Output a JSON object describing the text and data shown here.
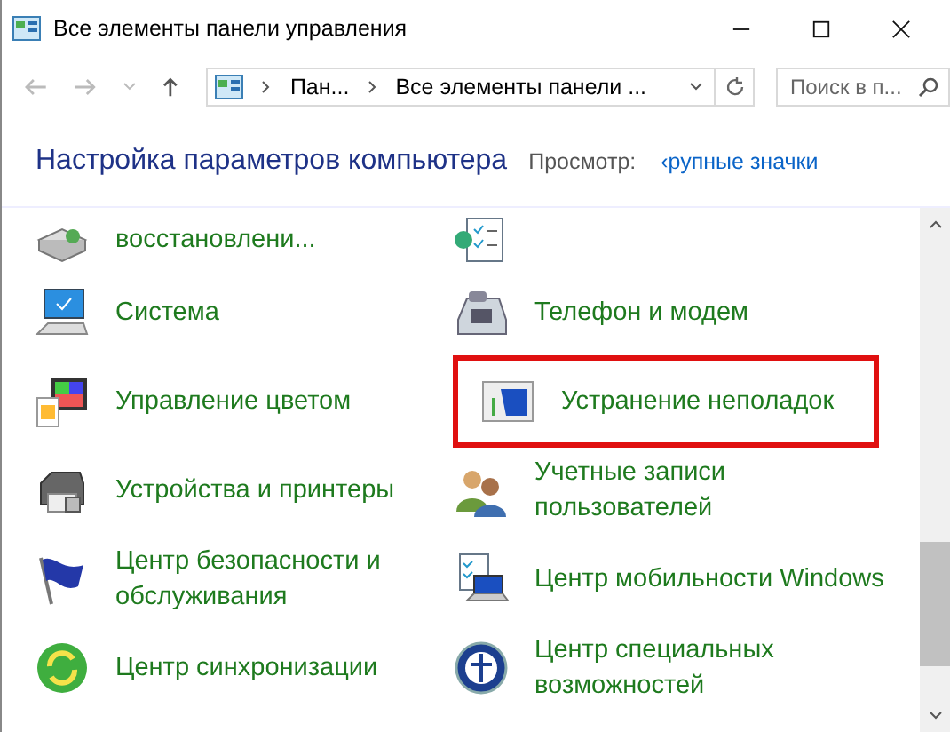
{
  "window": {
    "title": "Все элементы панели управления"
  },
  "address": {
    "crumbs": [
      "Пан...",
      "Все элементы панели ..."
    ]
  },
  "search": {
    "placeholder": "Поиск в п..."
  },
  "header": {
    "title": "Настройка параметров компьютера",
    "view_label": "Просмотр:",
    "view_value": "‹рупные значки"
  },
  "items": [
    {
      "label": "восстановлени...",
      "highlighted": false
    },
    {
      "highlighted": false
    },
    {
      "label": "Система",
      "highlighted": false
    },
    {
      "label": "Телефон и модем",
      "highlighted": false
    },
    {
      "label": "Управление цветом",
      "highlighted": false
    },
    {
      "label": "Устранение неполадок",
      "highlighted": true
    },
    {
      "label": "Устройства и принтеры",
      "highlighted": false
    },
    {
      "label": "Учетные записи пользователей",
      "highlighted": false
    },
    {
      "label": "Центр безопасности и обслуживания",
      "highlighted": false
    },
    {
      "label": "Центр мобильности Windows",
      "highlighted": false
    },
    {
      "label": "Центр синхронизации",
      "highlighted": false
    },
    {
      "label": "Центр специальных возможностей",
      "highlighted": false
    }
  ]
}
